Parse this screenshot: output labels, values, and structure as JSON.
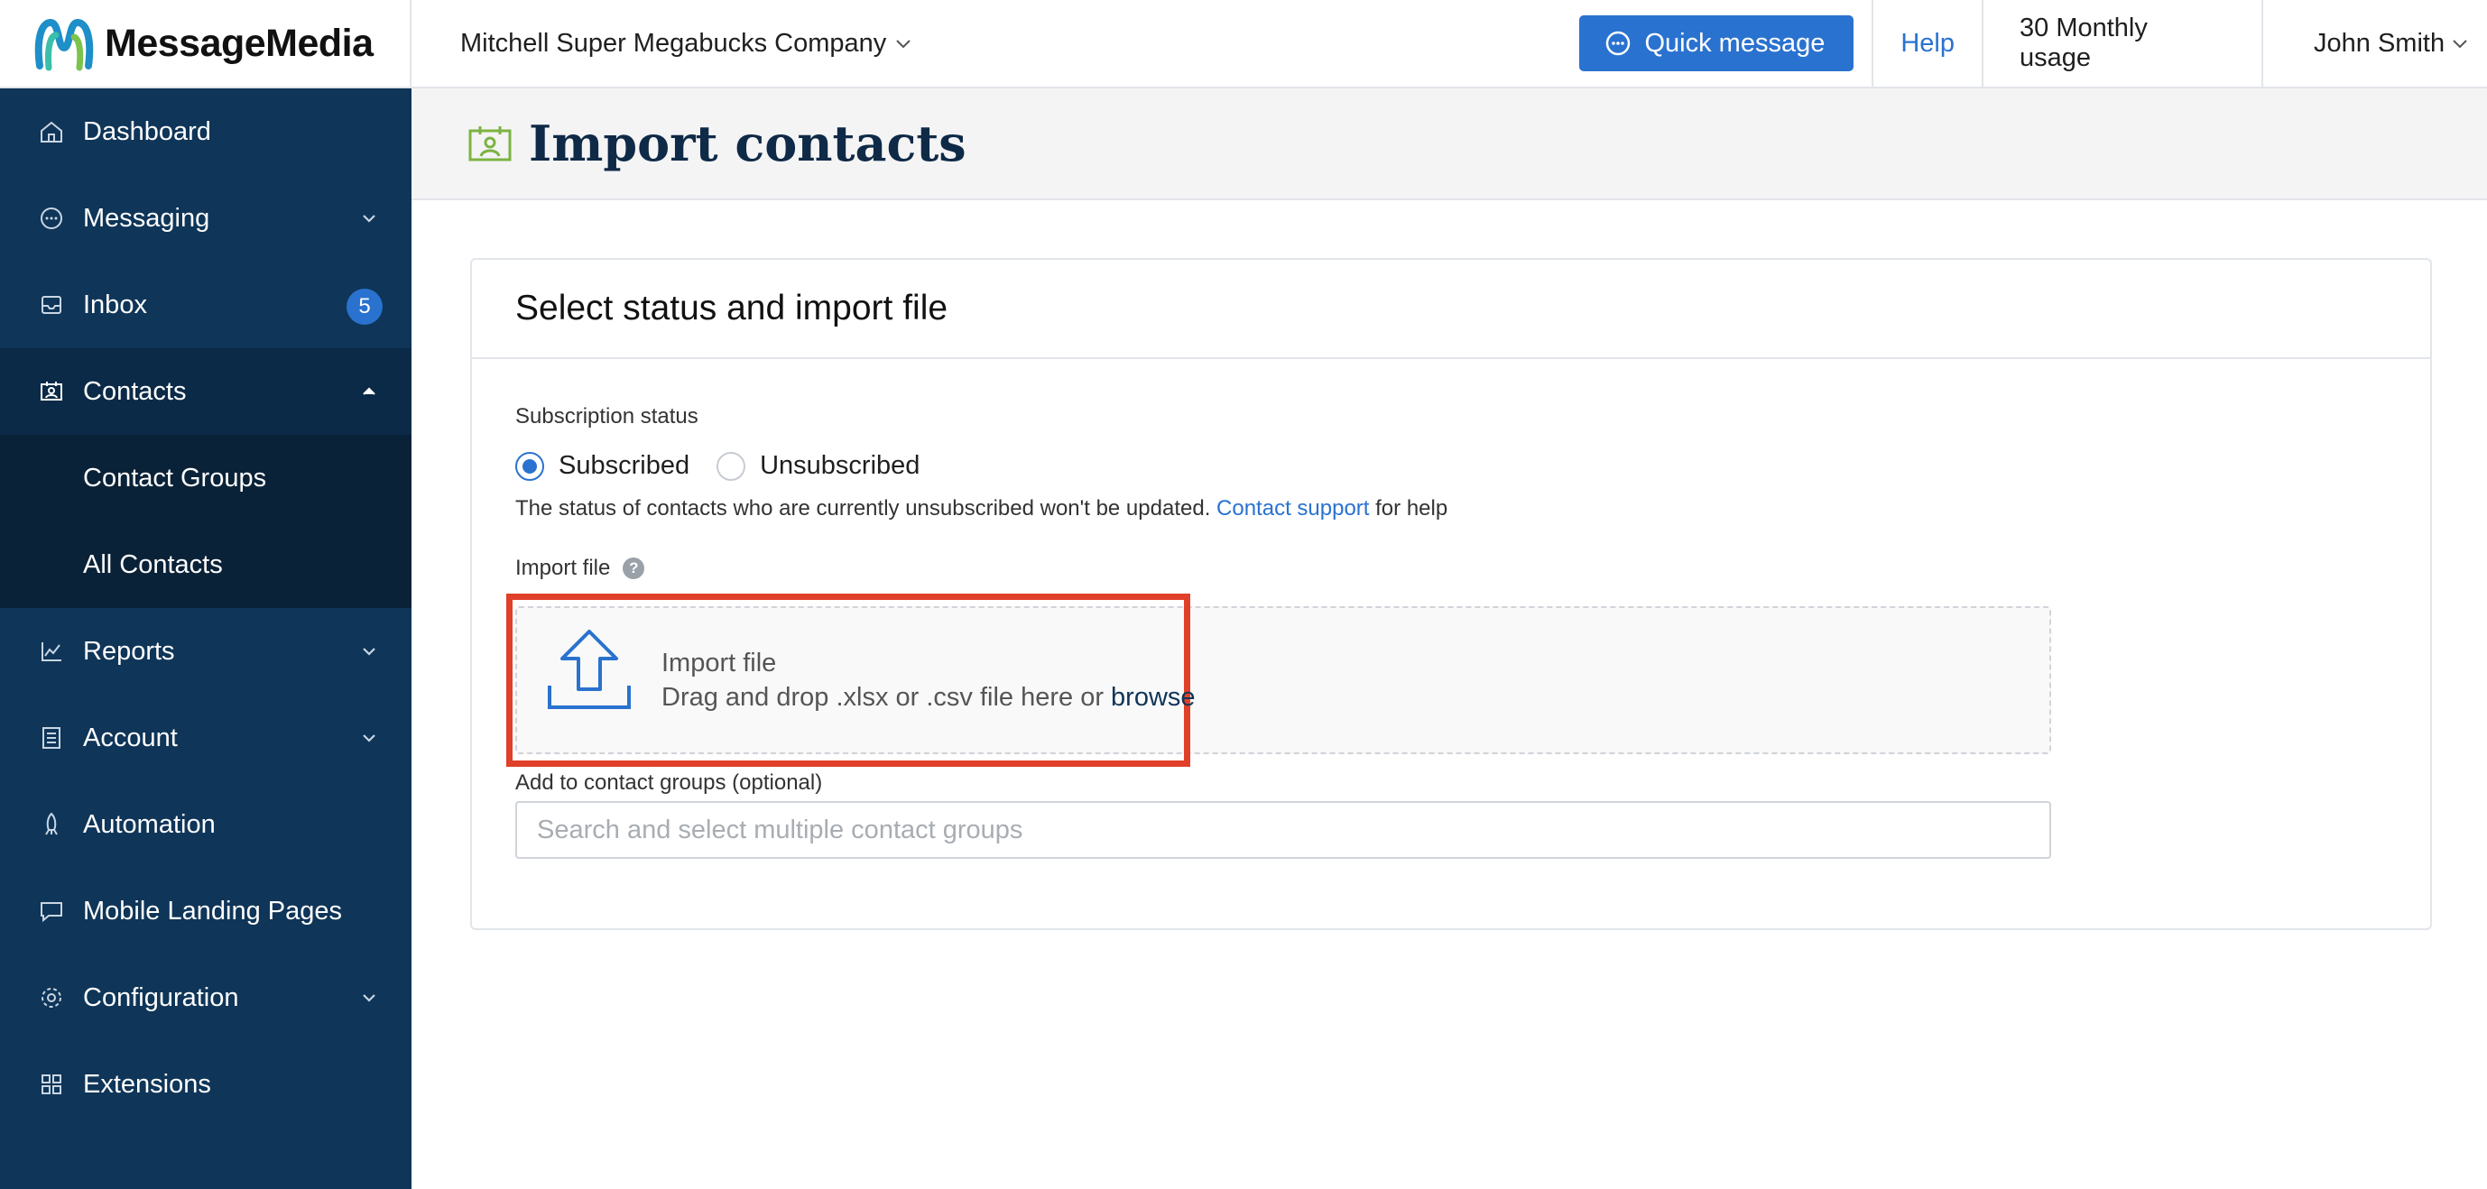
{
  "header": {
    "brand": "MessageMedia",
    "company": "Mitchell Super Megabucks Company",
    "quick_message": "Quick message",
    "help": "Help",
    "usage": "30 Monthly usage",
    "user": "John Smith"
  },
  "sidebar": {
    "items": [
      {
        "label": "Dashboard"
      },
      {
        "label": "Messaging"
      },
      {
        "label": "Inbox",
        "badge": "5"
      },
      {
        "label": "Contacts"
      },
      {
        "label": "Contact Groups"
      },
      {
        "label": "All Contacts"
      },
      {
        "label": "Reports"
      },
      {
        "label": "Account"
      },
      {
        "label": "Automation"
      },
      {
        "label": "Mobile Landing Pages"
      },
      {
        "label": "Configuration"
      },
      {
        "label": "Extensions"
      }
    ]
  },
  "page": {
    "title": "Import contacts"
  },
  "card": {
    "title": "Select status and import file",
    "subscription_label": "Subscription status",
    "radio_subscribed": "Subscribed",
    "radio_unsubscribed": "Unsubscribed",
    "selected_status": "Subscribed",
    "hint_text": "The status of contacts who are currently unsubscribed won't be updated.",
    "hint_link": "Contact support",
    "hint_suffix": "for help",
    "import_label": "Import file",
    "import_help": "?",
    "dropzone_title": "Import file",
    "dropzone_text": "Drag and drop .xlsx or .csv file here or",
    "dropzone_browse": "browse",
    "groups_label": "Add to contact groups (optional)",
    "groups_placeholder": "Search and select multiple contact groups"
  },
  "colors": {
    "sidebar_bg": "#0f3558",
    "accent": "#2a72cf",
    "highlight": "#e0402a",
    "page_icon": "#7cb342"
  },
  "icons": {
    "dashboard": "home-icon",
    "messaging": "chat-bubble-icon",
    "inbox": "inbox-icon",
    "contacts": "contact-card-icon",
    "reports": "line-chart-icon",
    "account": "document-list-icon",
    "automation": "rocket-icon",
    "landing_pages": "screen-chat-icon",
    "configuration": "gear-icon",
    "extensions": "grid-icon",
    "upload": "upload-arrow-icon"
  }
}
